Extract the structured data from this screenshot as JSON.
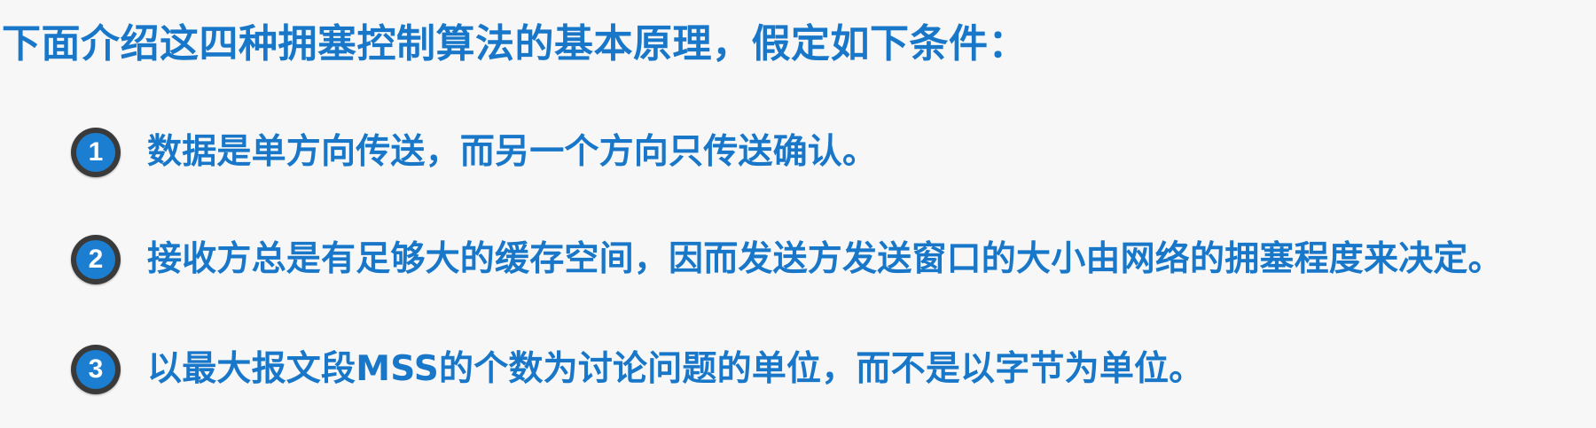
{
  "heading": "下面介绍这四种拥塞控制算法的基本原理，假定如下条件：",
  "items": [
    {
      "number": "1",
      "text": "数据是单方向传送，而另一个方向只传送确认。"
    },
    {
      "number": "2",
      "text": "接收方总是有足够大的缓存空间，因而发送方发送窗口的大小由网络的拥塞程度来决定。"
    },
    {
      "number": "3",
      "text": "以最大报文段MSS的个数为讨论问题的单位，而不是以字节为单位。"
    }
  ],
  "colors": {
    "text": "#1877c8",
    "badge_fill": "#1b7ed0",
    "badge_ring": "#3a3a3a",
    "background": "#f7f7f7"
  }
}
